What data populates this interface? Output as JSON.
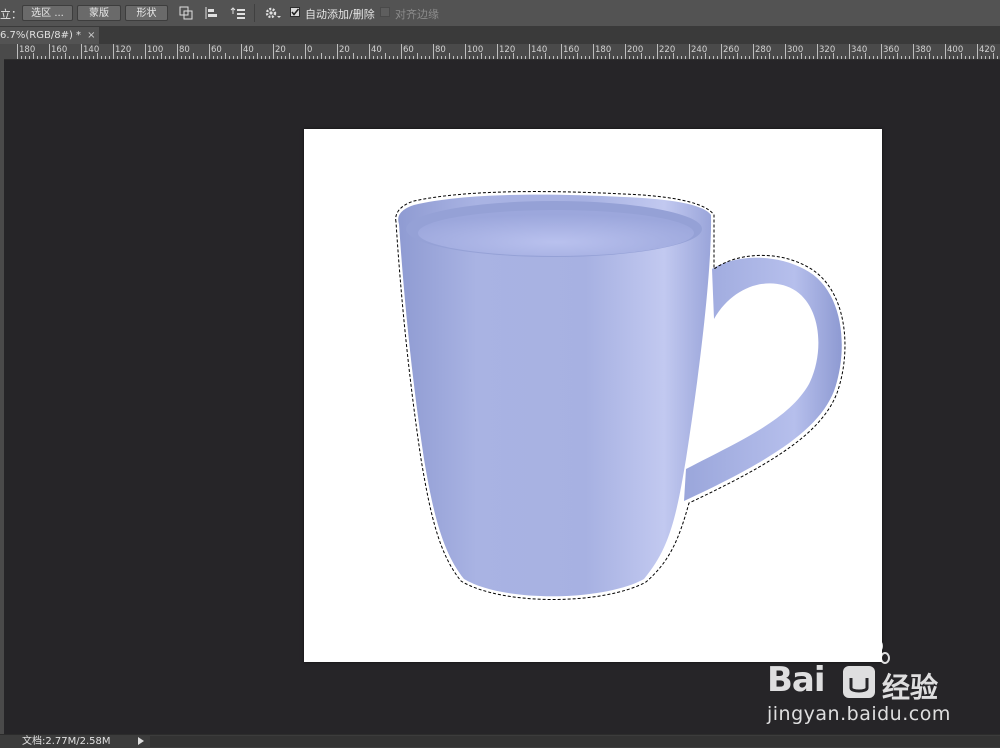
{
  "options_bar": {
    "prefix_label": "立：",
    "btn_selection": "选区 ...",
    "btn_mask": "蒙版",
    "btn_shape": "形状",
    "auto_add_delete_label": "自动添加/删除",
    "auto_add_delete_checked": true,
    "align_edges_label": "对齐边缘",
    "align_edges_checked": false
  },
  "document_tab": {
    "label": "6.7%(RGB/8#) *",
    "close": "×"
  },
  "ruler": {
    "labels": [
      "180",
      "160",
      "140",
      "120",
      "100",
      "80",
      "60",
      "40",
      "20",
      "0",
      "20",
      "40",
      "60",
      "80",
      "100",
      "120",
      "140",
      "160",
      "180",
      "200",
      "220",
      "240",
      "260",
      "280",
      "300",
      "320",
      "340",
      "360",
      "380",
      "400",
      "420"
    ]
  },
  "status_bar": {
    "doc_info": "文档:2.77M/2.58M"
  },
  "watermark": {
    "brand": "Bai",
    "brand_cn": "经验",
    "url": "jingyan.baidu.com"
  },
  "colors": {
    "workspace": "#262528",
    "mug": "#a3aee0",
    "canvas": "#ffffff"
  }
}
